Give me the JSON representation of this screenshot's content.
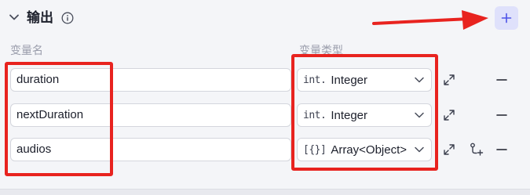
{
  "header": {
    "title": "输出",
    "add_label": "+"
  },
  "columns": {
    "name": "变量名",
    "type": "变量类型"
  },
  "rows": [
    {
      "name": "duration",
      "type_icon": "int.",
      "type": "Integer",
      "has_subfield": false
    },
    {
      "name": "nextDuration",
      "type_icon": "int.",
      "type": "Integer",
      "has_subfield": false
    },
    {
      "name": "audios",
      "type_icon": "[{}]",
      "type": "Array<Object>",
      "has_subfield": true
    }
  ],
  "icons": {
    "collapse": "chevron-down-icon",
    "info": "info-icon",
    "add": "plus-icon",
    "expand": "expand-icon",
    "remove": "minus-icon",
    "add_child": "add-subfield-icon"
  },
  "colors": {
    "annotation_red": "#e8231f",
    "add_button_bg": "#dfe1fb",
    "accent": "#4d53e8"
  }
}
